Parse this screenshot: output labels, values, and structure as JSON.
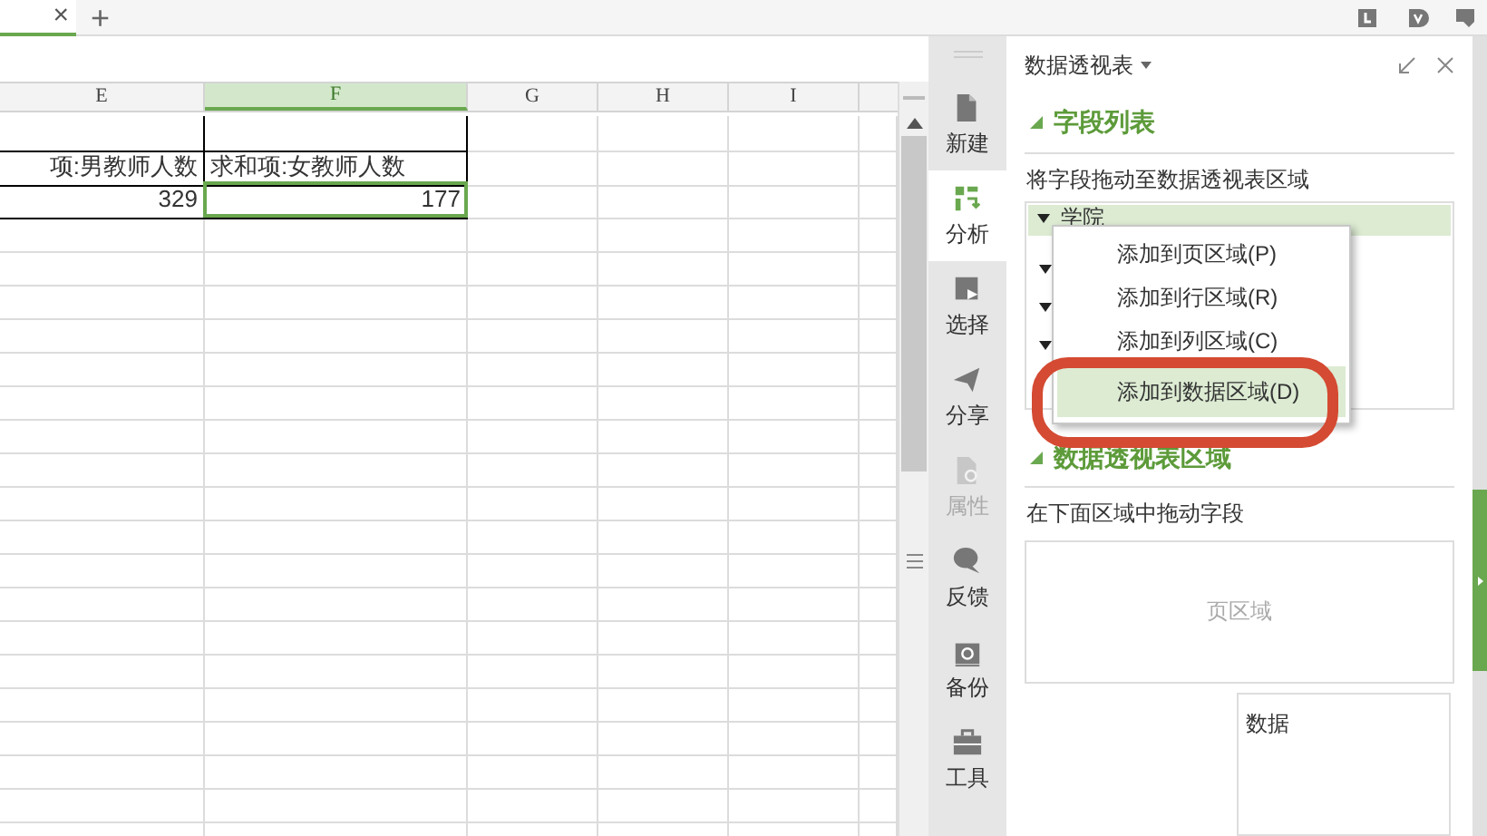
{
  "tab_bar": {
    "close": "×",
    "add": "+"
  },
  "sheet": {
    "columns": [
      {
        "label": "E",
        "selected": false
      },
      {
        "label": "F",
        "selected": true
      },
      {
        "label": "G",
        "selected": false
      },
      {
        "label": "H",
        "selected": false
      },
      {
        "label": "I",
        "selected": false
      }
    ],
    "rows": [
      {
        "kind": "text",
        "cells": [
          "项:男教师人数",
          "求和项:女教师人数"
        ]
      },
      {
        "kind": "number",
        "cells": [
          "329",
          "177"
        ]
      }
    ]
  },
  "sidebar": {
    "items": [
      {
        "label": "新建",
        "selected": false,
        "disabled": false
      },
      {
        "label": "分析",
        "selected": true,
        "disabled": false
      },
      {
        "label": "选择",
        "selected": false,
        "disabled": false
      },
      {
        "label": "分享",
        "selected": false,
        "disabled": false
      },
      {
        "label": "属性",
        "selected": false,
        "disabled": true
      },
      {
        "label": "反馈",
        "selected": false,
        "disabled": false
      },
      {
        "label": "备份",
        "selected": false,
        "disabled": false
      },
      {
        "label": "工具",
        "selected": false,
        "disabled": false
      }
    ]
  },
  "panel": {
    "title": "数据透视表",
    "field_section": {
      "title": "字段列表",
      "hint": "将字段拖动至数据透视表区域",
      "fields": [
        {
          "label": "学院",
          "selected": true
        }
      ]
    },
    "area_section": {
      "title": "数据透视表区域",
      "hint": "在下面区域中拖动字段",
      "page_area": "页区域",
      "data_area": "数据"
    }
  },
  "context_menu": {
    "items": [
      {
        "label": "添加到页区域(P)",
        "selected": false
      },
      {
        "label": "添加到行区域(R)",
        "selected": false
      },
      {
        "label": "添加到列区域(C)",
        "selected": false
      },
      {
        "label": "添加到数据区域(D)",
        "selected": true
      }
    ]
  }
}
